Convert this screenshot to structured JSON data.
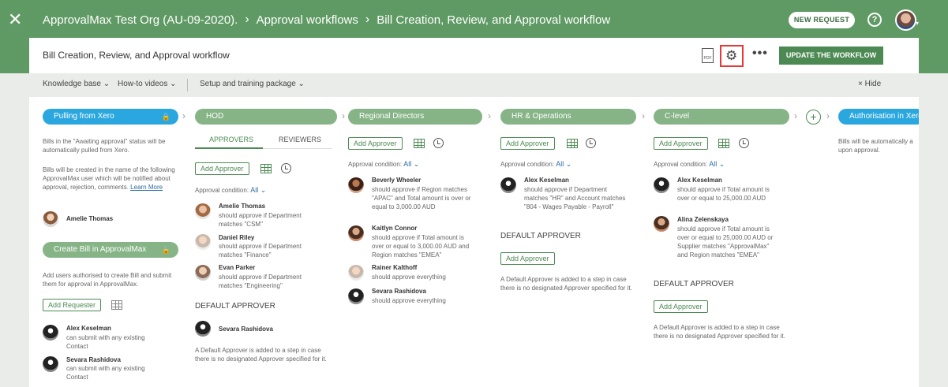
{
  "header": {
    "close_icon": "close-icon",
    "breadcrumb": [
      "ApprovalMax Test Org (AU-09-2020).",
      "Approval workflows",
      "Bill Creation, Review, and Approval workflow"
    ],
    "new_request": "NEW REQUEST",
    "help": "?"
  },
  "titlebar": {
    "title": "Bill Creation, Review, and Approval workflow",
    "pdf": "PDF",
    "update": "UPDATE THE WORKFLOW"
  },
  "links": {
    "knowledge": "Knowledge base ⌄",
    "howto": "How-to videos ⌄",
    "setup": "Setup and training package ⌄",
    "hide": "× Hide"
  },
  "steps": {
    "pull": {
      "label": "Pulling from Xero",
      "desc1": "Bills in the \"Awaiting approval\" status will be automatically pulled from Xero.",
      "desc2": "Bills will be created in the name of the following ApprovalMax user which will be notified about approval, rejection, comments.",
      "learn": "Learn More",
      "user": "Amelie Thomas"
    },
    "create": {
      "label": "Create Bill in ApprovalMax",
      "desc": "Add users authorised to create Bill and submit them for approval in ApprovalMax.",
      "add": "Add Requester",
      "r1_name": "Alex Keselman",
      "r1_text": "can submit with any existing Contact",
      "r2_name": "Sevara Rashidova",
      "r2_text": "can submit with any existing Contact"
    },
    "hod": {
      "label": "HOD",
      "tab1": "APPROVERS",
      "tab2": "REVIEWERS",
      "add": "Add Approver",
      "cond_label": "Approval condition:",
      "cond_value": "All ⌄",
      "a1_name": "Amelie Thomas",
      "a1_text": "should approve if Department matches \"CSM\"",
      "a2_name": "Daniel Riley",
      "a2_text": "should approve if Department matches \"Finance\"",
      "a3_name": "Evan Parker",
      "a3_text": "should approve if Department matches \"Engineering\"",
      "default": "DEFAULT APPROVER",
      "default_user": "Sevara Rashidova",
      "default_note": "A Default Approver is added to a step in case there is no designated Approver specified for it."
    },
    "regional": {
      "label": "Regional Directors",
      "add": "Add Approver",
      "cond_label": "Approval condition:",
      "cond_value": "All ⌄",
      "a1_name": "Beverly Wheeler",
      "a1_text": "should approve if Region matches \"APAC\" and Total amount is over or equal to 3,000.00 AUD",
      "a2_name": "Kaitlyn Connor",
      "a2_text": "should approve if Total amount is over or equal to 3,000.00 AUD and Region matches \"EMEA\"",
      "a3_name": "Rainer Kalthoff",
      "a3_text": "should approve everything",
      "a4_name": "Sevara Rashidova",
      "a4_text": "should approve everything"
    },
    "hr": {
      "label": "HR & Operations",
      "add": "Add Approver",
      "cond_label": "Approval condition:",
      "cond_value": "All ⌄",
      "a1_name": "Alex Keselman",
      "a1_text": "should approve if Department matches \"HR\" and Account matches \"804 - Wages Payable - Payroll\"",
      "default": "DEFAULT APPROVER",
      "default_add": "Add Approver",
      "default_note": "A Default Approver is added to a step in case there is no designated Approver specified for it."
    },
    "clevel": {
      "label": "C-level",
      "add": "Add Approver",
      "cond_label": "Approval condition:",
      "cond_value": "All ⌄",
      "a1_name": "Alex Keselman",
      "a1_text": "should approve if Total amount is over or equal to 25,000.00 AUD",
      "a2_name": "Alina Zelenskaya",
      "a2_text": "should approve if Total amount is over or equal to 25,000.00 AUD or Supplier matches \"ApprovalMax\" and Region matches \"EMEA\"",
      "default": "DEFAULT APPROVER",
      "default_add": "Add Approver",
      "default_note": "A Default Approver is added to a step in case there is no designated Approver specified for it."
    },
    "auth": {
      "label": "Authorisation in Xero",
      "desc": "Bills will be automatically a upon approval."
    }
  },
  "colors": {
    "header": "#5f9a64",
    "accent": "#4d8a53",
    "blue_pill": "#2ba7df",
    "green_pill": "#86b487",
    "highlight": "#e53935"
  }
}
